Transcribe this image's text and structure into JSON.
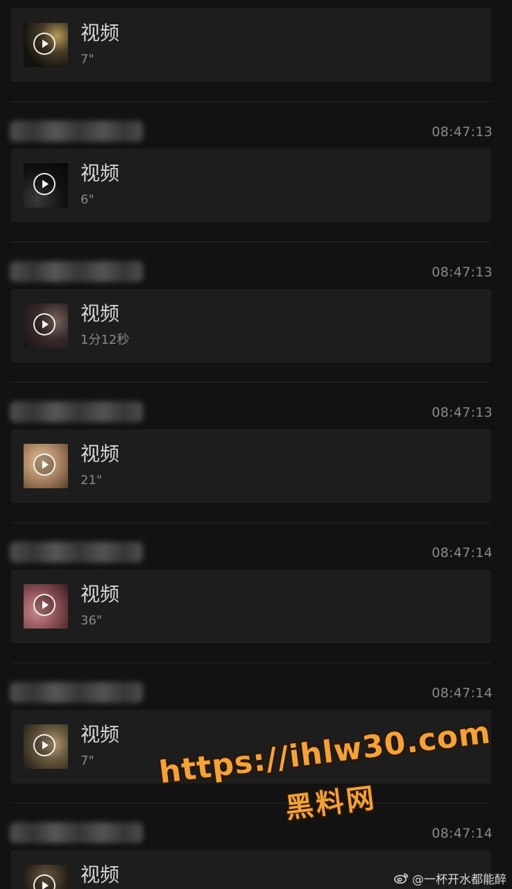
{
  "messages": [
    {
      "sender_visible": false,
      "time": "",
      "title": "视频",
      "duration": "7\"",
      "thumb_colors": [
        "#6b5a3a",
        "#1e1a14"
      ]
    },
    {
      "sender_visible": true,
      "time": "08:47:13",
      "title": "视频",
      "duration": "6\"",
      "thumb_colors": [
        "#1a1a1a",
        "#0a0a0a"
      ]
    },
    {
      "sender_visible": true,
      "time": "08:47:13",
      "title": "视频",
      "duration": "1分12秒",
      "thumb_colors": [
        "#3a2a2a",
        "#5a4a48"
      ]
    },
    {
      "sender_visible": true,
      "time": "08:47:13",
      "title": "视频",
      "duration": "21\"",
      "thumb_colors": [
        "#c9a27a",
        "#8a6848"
      ]
    },
    {
      "sender_visible": true,
      "time": "08:47:14",
      "title": "视频",
      "duration": "36\"",
      "thumb_colors": [
        "#b07878",
        "#5a2a2e"
      ]
    },
    {
      "sender_visible": true,
      "time": "08:47:14",
      "title": "视频",
      "duration": "7\"",
      "thumb_colors": [
        "#7a6a50",
        "#2a241a"
      ]
    },
    {
      "sender_visible": true,
      "time": "08:47:14",
      "title": "视频",
      "duration": "",
      "thumb_colors": [
        "#4a3a2a",
        "#1a1612"
      ]
    }
  ],
  "watermark": {
    "url": "https://ihlw30.com",
    "name": "黑料网"
  },
  "credit": {
    "text": "@一杯开水都能醉",
    "icon": "weibo-icon"
  },
  "colors": {
    "background": "#121212",
    "card": "#1d1d1d",
    "watermark": "#f2a23a"
  }
}
